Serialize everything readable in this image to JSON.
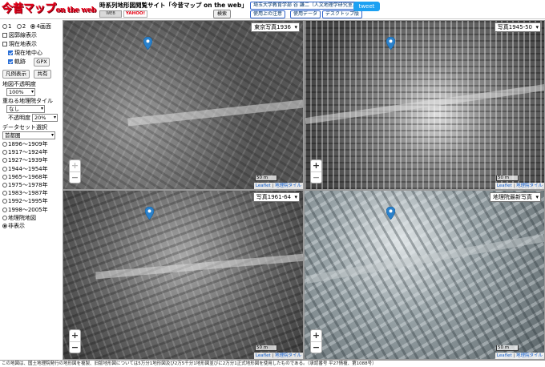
{
  "header": {
    "logo": "今昔マップ",
    "logo_suffix": "on the web",
    "site_title": "時系列地形図閲覧サイト「今昔マップ on the web」",
    "badge1": "WEB",
    "badge2": "YAHOO!",
    "search_label": "検索",
    "author": "埼玉大学教育学部 谷 謙二（人文地理学研究室）",
    "links": [
      "使用上の注意",
      "使用データ",
      "デスクトップ版"
    ],
    "tweet_label": "tweet"
  },
  "sidebar": {
    "split_options": [
      "1",
      "2",
      "4画面"
    ],
    "split_selected": "4画面",
    "checks": [
      {
        "label": "図郭線表示",
        "checked": false
      },
      {
        "label": "現在地表示",
        "checked": false
      },
      {
        "label": "現在地中心",
        "checked": true
      },
      {
        "label": "軌跡",
        "checked": true
      }
    ],
    "gpx_label": "GPX",
    "legend_button": "凡例表示",
    "share_button": "共有",
    "opacity_label": "地図不透明度",
    "opacity_value": "100%",
    "overlay_label": "重ねる地理院タイル",
    "overlay_value": "なし",
    "overlay_opacity_label": "不透明度",
    "overlay_opacity_value": "20%",
    "dataset_label": "データセット選択",
    "dataset_value": "首都圏",
    "periods": [
      {
        "label": "1896〜1909年",
        "selected": false
      },
      {
        "label": "1917〜1924年",
        "selected": false
      },
      {
        "label": "1927〜1939年",
        "selected": false
      },
      {
        "label": "1944〜1954年",
        "selected": false
      },
      {
        "label": "1965〜1968年",
        "selected": false
      },
      {
        "label": "1975〜1978年",
        "selected": false
      },
      {
        "label": "1983〜1987年",
        "selected": false
      },
      {
        "label": "1992〜1995年",
        "selected": false
      },
      {
        "label": "1998〜2005年",
        "selected": false
      },
      {
        "label": "地理院地図",
        "selected": false
      },
      {
        "label": "非表示",
        "selected": true
      }
    ]
  },
  "maps": [
    {
      "layer": "東京写真1936",
      "scale": "50 m",
      "attrib_a": "Leaflet",
      "attrib_b": "地理院タイル"
    },
    {
      "layer": "写真1945-50",
      "scale": "50 m",
      "attrib_a": "Leaflet",
      "attrib_b": "地理院タイル"
    },
    {
      "layer": "写真1961-64",
      "scale": "50 m",
      "attrib_a": "Leaflet",
      "attrib_b": "地理院タイル"
    },
    {
      "layer": "地理院最新写真",
      "scale": "50 m",
      "attrib_a": "Leaflet",
      "attrib_b": "地理院タイル"
    }
  ],
  "colors": {
    "pin": "#2a81cb",
    "logo": "#e6001a",
    "tweet": "#1da1f2"
  },
  "footer": "この地図は、国土地理院発行の地形図を複製、旧版地形図については5万分1地形図及び2万5千分1地形図並びに2万分1正式地形図を使用したものである。（承認番号 平27情複、第1088号）"
}
